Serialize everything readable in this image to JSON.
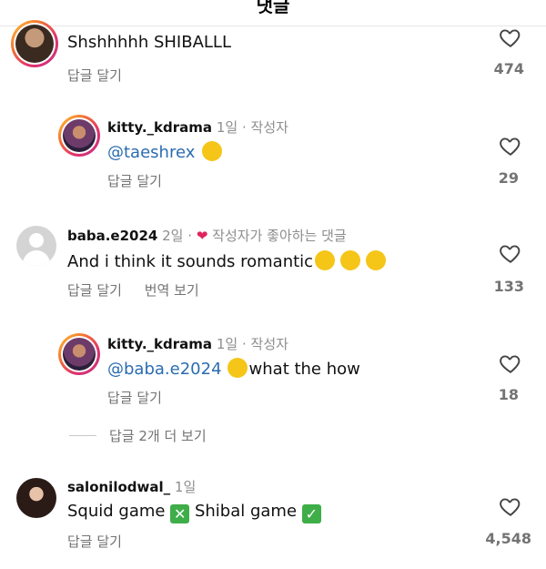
{
  "header": {
    "title": "댓글"
  },
  "comments": [
    {
      "text": "Shshhhhh SHIBALLL",
      "reply_label": "답글 달기",
      "likes": "474"
    },
    {
      "user": "kitty._kdrama",
      "age": "1일",
      "sep": "·",
      "author": "작성자",
      "mention": "@taeshrex",
      "reply_label": "답글 달기",
      "likes": "29"
    },
    {
      "user": "baba.e2024",
      "age": "2일",
      "sep": "·",
      "liked_label": "작성자가 좋아하는 댓글",
      "text": "And i think it sounds romantic",
      "reply_label": "답글 달기",
      "translate_label": "번역 보기",
      "likes": "133"
    },
    {
      "user": "kitty._kdrama",
      "age": "1일",
      "sep": "·",
      "author": "작성자",
      "mention": "@baba.e2024",
      "text": "what the how",
      "reply_label": "답글 달기",
      "likes": "18"
    },
    {
      "user": "salonilodwal_",
      "age": "1일",
      "text_part1": "Squid game",
      "text_part2": "Shibal game",
      "reply_label": "답글 달기",
      "likes": "4,548"
    }
  ],
  "more_replies": "답글 2개 더 보기",
  "colors": {
    "mention": "#2b6cb0",
    "heart_red": "#e0245e",
    "muted": "#737373"
  }
}
